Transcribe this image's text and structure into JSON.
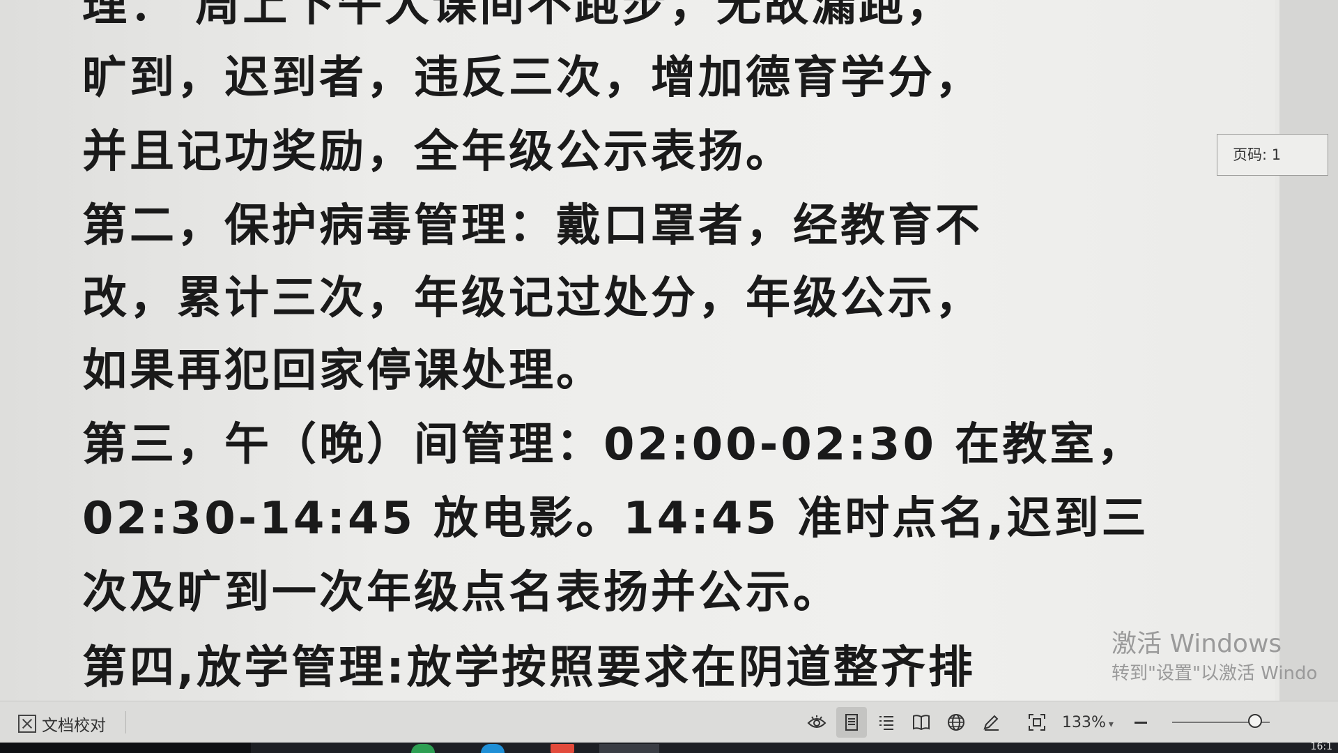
{
  "document": {
    "lines": [
      "理：    周上下午大课间不跑步，无故漏跑，",
      "旷到，迟到者，违反三次，增加德育学分，",
      "并且记功奖励，全年级公示表扬。",
      "第二，保护病毒管理：戴口罩者，经教育不",
      "改，累计三次，年级记过处分，年级公示，",
      "如果再犯回家停课处理。",
      "第三，午（晚）间管理：02:00-02:30 在教室，",
      "02:30-14:45 放电影。14:45 准时点名,迟到三",
      "次及旷到一次年级点名表扬并公示。",
      "第四,放学管理:放学按照要求在阴道整齐排"
    ]
  },
  "page_indicator": "页码: 1",
  "watermark": {
    "title": "激活 Windows",
    "subtitle": "转到\"设置\"以激活 Windo"
  },
  "status_bar": {
    "proofread_label": "文档校对",
    "zoom_label": "133%",
    "zoom_percent": 133,
    "zoom_slider_position": 0.85,
    "view_icons": [
      "eye-icon",
      "page-view-icon",
      "outline-view-icon",
      "read-view-icon",
      "web-view-icon",
      "pen-icon",
      "fit-page-icon"
    ],
    "active_view": "page-view-icon"
  },
  "taskbar": {
    "clock": "16:1"
  },
  "colors": {
    "text": "#1a1a1a",
    "page_bg": "#ececea",
    "statusbar_bg": "#dcdcda",
    "taskbar_bg": "#1d1f24"
  }
}
